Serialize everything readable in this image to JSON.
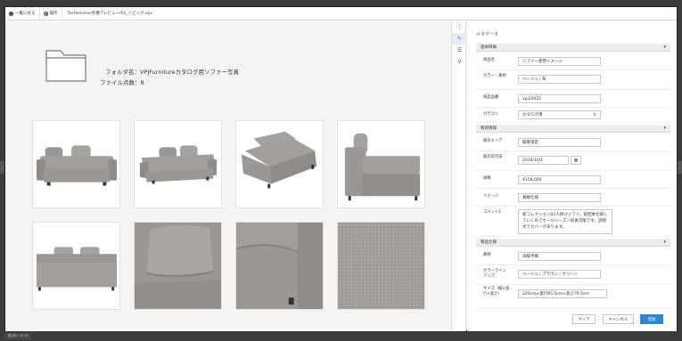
{
  "toolbar": {
    "back_label": "一覧に戻る",
    "actions_label": "操作",
    "path": "TestVolume/各種プレビュー/02_リビング.eps"
  },
  "preview": {
    "folder_name": "フォルダ名：VPJFurnitureカタログ用ソファー写真",
    "file_count": "ファイル点数：8"
  },
  "metadata": {
    "title": "メタデータ",
    "sections": {
      "basic": "基本情報",
      "sales": "販売情報",
      "spec": "製品仕様"
    },
    "fields": {
      "product_name_label": "商品名",
      "product_name_value": "ソファー使用イメージ",
      "color_label": "カラー・素材",
      "color_value": "ベージュ / 布",
      "product_no_label": "商品品番",
      "product_no_value": "vpj20022",
      "category_label": "カテゴリ",
      "category_value": "カタログ用",
      "area_label": "販売エリア",
      "area_value": "関東限定",
      "date_label": "販売年月日",
      "date_value": "2016/10/1",
      "price_label": "価格",
      "price_value": "¥158,000",
      "image_label": "イメージ",
      "image_value": "素敵仕様",
      "comment_label": "コメント1",
      "comment_value": "新コレクション02人掛けソファ。前回本仕様していくのでセールシーズン前後可能です。説明文でカバーがあります。",
      "material_label": "素材",
      "material_value": "高級平織",
      "colorline_label": "カラーラインアップ",
      "colorline_value": "ベージュ / ブラウン / グリーン",
      "size_label": "サイズ（幅×奥行×高さ）",
      "size_value": "220cm×奥行85.5cm×高さ79.5cm"
    },
    "buttons": {
      "clear": "クリア",
      "cancel": "キャンセル",
      "save": "登録"
    }
  },
  "statusbar": {
    "text": "表示中：8 / 8"
  },
  "colors": {
    "accent": "#2f86d1",
    "fabric": "#a29e9b",
    "fabric_dark": "#8a8683"
  }
}
